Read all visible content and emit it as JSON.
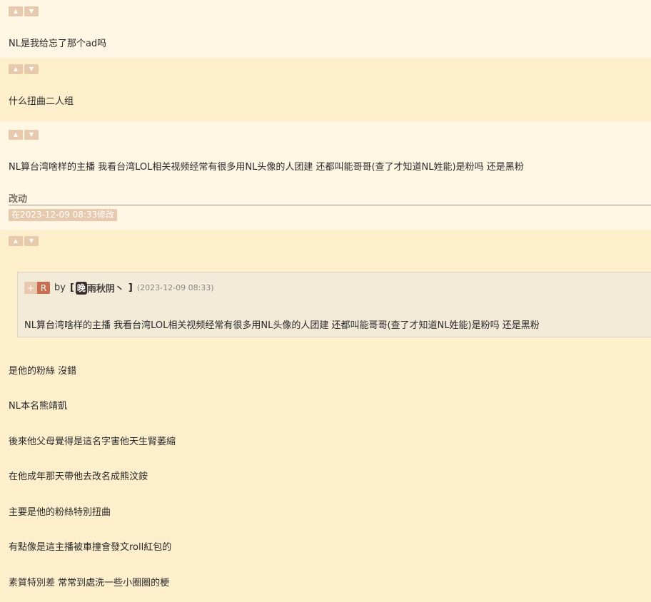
{
  "icons": {
    "up": "thumbs-up-icon",
    "down": "thumbs-down-icon"
  },
  "colors": {
    "bg_a": "#fff6e3",
    "bg_b": "#fdefcc",
    "vote": "#e7c9ad",
    "r_badge": "#c96f4f"
  },
  "posts": [
    {
      "text": "NL是我给忘了那个ad吗"
    },
    {
      "text": "什么扭曲二人组"
    },
    {
      "text": "NL算台湾啥样的主播 我看台湾LOL相关视频经常有很多用NL头像的人团建 还都叫能哥哥(查了才知道NL姓能)是粉吗 还是黑粉",
      "edit_label": "改动",
      "edit_badge": "在2023-12-09 08:33修改"
    },
    {
      "quote": {
        "plus": "+",
        "r": "R",
        "by": "by",
        "bracket_open": "[",
        "avatar_char": "晚",
        "user": "雨秋阴丶",
        "bracket_close": "]",
        "date": "(2023-12-09 08:33)",
        "text": "NL算台湾啥样的主播 我看台湾LOL相关视频经常有很多用NL头像的人团建 还都叫能哥哥(查了才知道NL姓能)是粉吗 还是黑粉"
      },
      "lines": [
        "是他的粉絲 沒錯",
        "NL本名熊靖凱",
        "後來他父母覺得是這名字害他天生腎萎縮",
        "在他成年那天帶他去改名成熊汶銨",
        "主要是他的粉絲特別扭曲",
        "有點像是這主播被車撞會發文roll紅包的",
        "素質特別差 常常到處洗一些小圈圈的梗"
      ]
    }
  ]
}
